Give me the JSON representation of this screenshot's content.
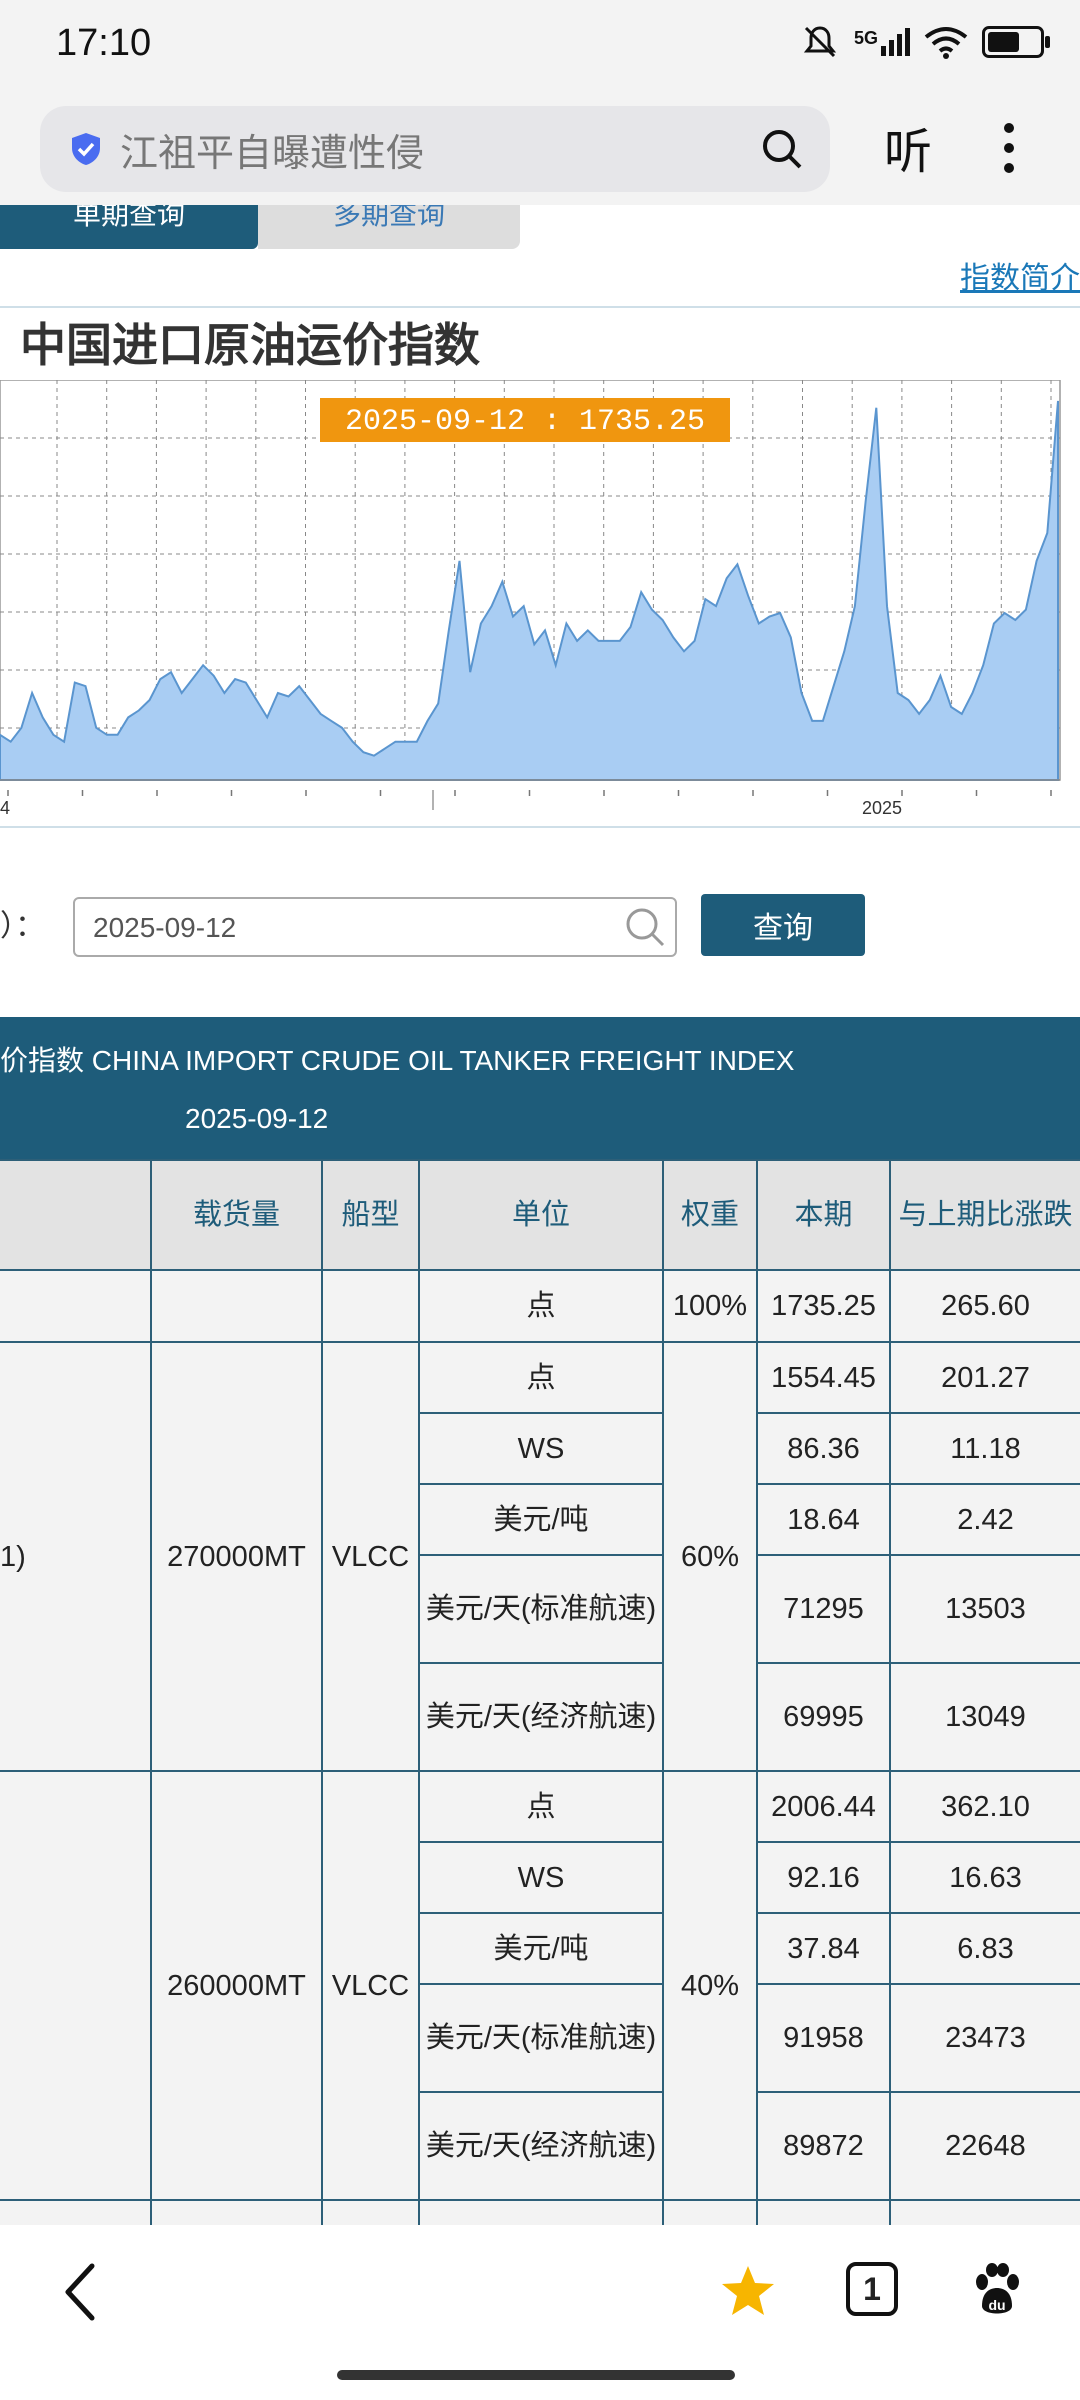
{
  "status_bar": {
    "time": "17:10",
    "signal": "5G"
  },
  "browser": {
    "search_text": "江祖平自曝遭性侵",
    "listen_label": "听"
  },
  "tabs": {
    "single": "单期查询",
    "multi": "多期查询"
  },
  "intro_link": "指数简介",
  "chart": {
    "title": "中国进口原油运价指数",
    "tooltip": "2025-09-12 : 1735.25"
  },
  "chart_data": {
    "type": "area",
    "title": "中国进口原油运价指数",
    "x_tick_labels": [
      "4",
      "2025"
    ],
    "tooltip": {
      "x": "2025-09-12",
      "y": 1735.25
    },
    "grid": true,
    "color": "#a9cdf3",
    "series": [
      {
        "values": [
          780,
          760,
          800,
          900,
          830,
          780,
          760,
          930,
          920,
          800,
          780,
          780,
          830,
          850,
          880,
          940,
          960,
          900,
          940,
          980,
          950,
          900,
          940,
          930,
          880,
          830,
          900,
          890,
          920,
          880,
          840,
          820,
          800,
          760,
          730,
          720,
          740,
          760,
          760,
          760,
          820,
          870,
          1080,
          1280,
          960,
          1100,
          1150,
          1220,
          1120,
          1150,
          1040,
          1080,
          980,
          1100,
          1050,
          1080,
          1050,
          1050,
          1050,
          1090,
          1190,
          1140,
          1110,
          1060,
          1020,
          1050,
          1170,
          1150,
          1230,
          1270,
          1180,
          1100,
          1120,
          1130,
          1060,
          900,
          820,
          820,
          920,
          1020,
          1150,
          1450,
          1720,
          1150,
          900,
          880,
          840,
          880,
          950,
          860,
          840,
          900,
          980,
          1100,
          1130,
          1110,
          1140,
          1280,
          1360,
          1740
        ]
      }
    ],
    "ylim": [
      650,
      1800
    ]
  },
  "form": {
    "date_label": "）：",
    "date_value": "2025-09-12",
    "query_label": "查询"
  },
  "table": {
    "title": "价指数 CHINA IMPORT CRUDE OIL TANKER FREIGHT INDEX",
    "date": "2025-09-12",
    "columns": [
      "载货量",
      "船型",
      "单位",
      "权重",
      "本期",
      "与上期比涨跌"
    ],
    "total_row": {
      "unit": "点",
      "weight": "100%",
      "current": "1735.25",
      "change": "265.60"
    },
    "group1": {
      "label": "1)",
      "cargo": "270000MT",
      "ship": "VLCC",
      "weight": "60%",
      "rows": [
        {
          "unit": "点",
          "current": "1554.45",
          "change": "201.27"
        },
        {
          "unit": "WS",
          "current": "86.36",
          "change": "11.18"
        },
        {
          "unit": "美元/吨",
          "current": "18.64",
          "change": "2.42"
        },
        {
          "unit": "美元/天(标准航速)",
          "current": "71295",
          "change": "13503"
        },
        {
          "unit": "美元/天(经济航速)",
          "current": "69995",
          "change": "13049"
        }
      ]
    },
    "group2": {
      "cargo": "260000MT",
      "ship": "VLCC",
      "weight": "40%",
      "rows": [
        {
          "unit": "点",
          "current": "2006.44",
          "change": "362.10"
        },
        {
          "unit": "WS",
          "current": "92.16",
          "change": "16.63"
        },
        {
          "unit": "美元/吨",
          "current": "37.84",
          "change": "6.83"
        },
        {
          "unit": "美元/天(标准航速)",
          "current": "91958",
          "change": "23473"
        },
        {
          "unit": "美元/天(经济航速)",
          "current": "89872",
          "change": "22648"
        }
      ]
    }
  },
  "bottom_nav": {
    "tab_count": "1"
  }
}
